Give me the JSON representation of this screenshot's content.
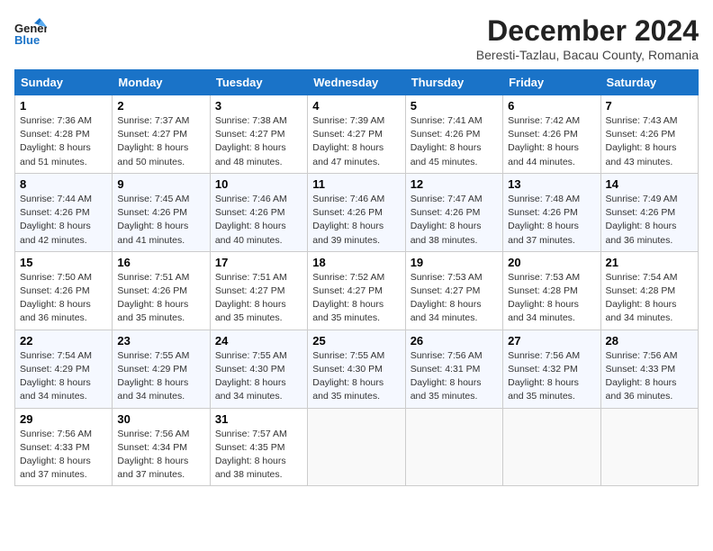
{
  "logo": {
    "line1": "General",
    "line2": "Blue"
  },
  "title": "December 2024",
  "location": "Beresti-Tazlau, Bacau County, Romania",
  "days_of_week": [
    "Sunday",
    "Monday",
    "Tuesday",
    "Wednesday",
    "Thursday",
    "Friday",
    "Saturday"
  ],
  "weeks": [
    [
      {
        "day": 1,
        "sunrise": "7:36 AM",
        "sunset": "4:28 PM",
        "daylight": "8 hours and 51 minutes."
      },
      {
        "day": 2,
        "sunrise": "7:37 AM",
        "sunset": "4:27 PM",
        "daylight": "8 hours and 50 minutes."
      },
      {
        "day": 3,
        "sunrise": "7:38 AM",
        "sunset": "4:27 PM",
        "daylight": "8 hours and 48 minutes."
      },
      {
        "day": 4,
        "sunrise": "7:39 AM",
        "sunset": "4:27 PM",
        "daylight": "8 hours and 47 minutes."
      },
      {
        "day": 5,
        "sunrise": "7:41 AM",
        "sunset": "4:26 PM",
        "daylight": "8 hours and 45 minutes."
      },
      {
        "day": 6,
        "sunrise": "7:42 AM",
        "sunset": "4:26 PM",
        "daylight": "8 hours and 44 minutes."
      },
      {
        "day": 7,
        "sunrise": "7:43 AM",
        "sunset": "4:26 PM",
        "daylight": "8 hours and 43 minutes."
      }
    ],
    [
      {
        "day": 8,
        "sunrise": "7:44 AM",
        "sunset": "4:26 PM",
        "daylight": "8 hours and 42 minutes."
      },
      {
        "day": 9,
        "sunrise": "7:45 AM",
        "sunset": "4:26 PM",
        "daylight": "8 hours and 41 minutes."
      },
      {
        "day": 10,
        "sunrise": "7:46 AM",
        "sunset": "4:26 PM",
        "daylight": "8 hours and 40 minutes."
      },
      {
        "day": 11,
        "sunrise": "7:46 AM",
        "sunset": "4:26 PM",
        "daylight": "8 hours and 39 minutes."
      },
      {
        "day": 12,
        "sunrise": "7:47 AM",
        "sunset": "4:26 PM",
        "daylight": "8 hours and 38 minutes."
      },
      {
        "day": 13,
        "sunrise": "7:48 AM",
        "sunset": "4:26 PM",
        "daylight": "8 hours and 37 minutes."
      },
      {
        "day": 14,
        "sunrise": "7:49 AM",
        "sunset": "4:26 PM",
        "daylight": "8 hours and 36 minutes."
      }
    ],
    [
      {
        "day": 15,
        "sunrise": "7:50 AM",
        "sunset": "4:26 PM",
        "daylight": "8 hours and 36 minutes."
      },
      {
        "day": 16,
        "sunrise": "7:51 AM",
        "sunset": "4:26 PM",
        "daylight": "8 hours and 35 minutes."
      },
      {
        "day": 17,
        "sunrise": "7:51 AM",
        "sunset": "4:27 PM",
        "daylight": "8 hours and 35 minutes."
      },
      {
        "day": 18,
        "sunrise": "7:52 AM",
        "sunset": "4:27 PM",
        "daylight": "8 hours and 35 minutes."
      },
      {
        "day": 19,
        "sunrise": "7:53 AM",
        "sunset": "4:27 PM",
        "daylight": "8 hours and 34 minutes."
      },
      {
        "day": 20,
        "sunrise": "7:53 AM",
        "sunset": "4:28 PM",
        "daylight": "8 hours and 34 minutes."
      },
      {
        "day": 21,
        "sunrise": "7:54 AM",
        "sunset": "4:28 PM",
        "daylight": "8 hours and 34 minutes."
      }
    ],
    [
      {
        "day": 22,
        "sunrise": "7:54 AM",
        "sunset": "4:29 PM",
        "daylight": "8 hours and 34 minutes."
      },
      {
        "day": 23,
        "sunrise": "7:55 AM",
        "sunset": "4:29 PM",
        "daylight": "8 hours and 34 minutes."
      },
      {
        "day": 24,
        "sunrise": "7:55 AM",
        "sunset": "4:30 PM",
        "daylight": "8 hours and 34 minutes."
      },
      {
        "day": 25,
        "sunrise": "7:55 AM",
        "sunset": "4:30 PM",
        "daylight": "8 hours and 35 minutes."
      },
      {
        "day": 26,
        "sunrise": "7:56 AM",
        "sunset": "4:31 PM",
        "daylight": "8 hours and 35 minutes."
      },
      {
        "day": 27,
        "sunrise": "7:56 AM",
        "sunset": "4:32 PM",
        "daylight": "8 hours and 35 minutes."
      },
      {
        "day": 28,
        "sunrise": "7:56 AM",
        "sunset": "4:33 PM",
        "daylight": "8 hours and 36 minutes."
      }
    ],
    [
      {
        "day": 29,
        "sunrise": "7:56 AM",
        "sunset": "4:33 PM",
        "daylight": "8 hours and 37 minutes."
      },
      {
        "day": 30,
        "sunrise": "7:56 AM",
        "sunset": "4:34 PM",
        "daylight": "8 hours and 37 minutes."
      },
      {
        "day": 31,
        "sunrise": "7:57 AM",
        "sunset": "4:35 PM",
        "daylight": "8 hours and 38 minutes."
      },
      null,
      null,
      null,
      null
    ]
  ],
  "labels": {
    "sunrise": "Sunrise:",
    "sunset": "Sunset:",
    "daylight": "Daylight:"
  }
}
